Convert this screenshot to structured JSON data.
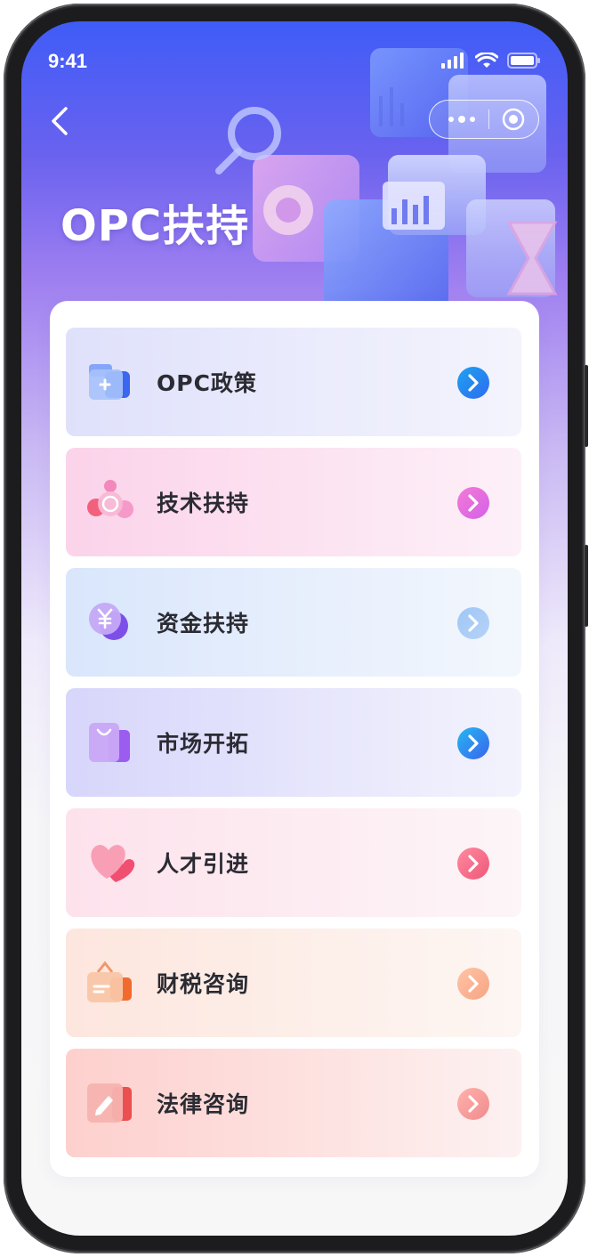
{
  "status_bar": {
    "time": "9:41"
  },
  "header": {
    "title": "OPC扶持"
  },
  "menu": [
    {
      "label": "OPC政策",
      "icon": "folder-add-icon",
      "bg_from": "#dfe1fb",
      "bg_to": "#f4f4fd",
      "arrow_from": "#1fa2f0",
      "arrow_to": "#2d6cf0"
    },
    {
      "label": "技术扶持",
      "icon": "tech-cluster-icon",
      "bg_from": "#fbd3ea",
      "bg_to": "#fdf0f8",
      "arrow_from": "#f47ad6",
      "arrow_to": "#d361e9"
    },
    {
      "label": "资金扶持",
      "icon": "yuan-coin-icon",
      "bg_from": "#d9e6fc",
      "bg_to": "#f3f7fd",
      "arrow_from": "#9ec7f6",
      "arrow_to": "#b7d2f7"
    },
    {
      "label": "市场开拓",
      "icon": "shopping-bag-icon",
      "bg_from": "#d7d6fb",
      "bg_to": "#f3f3fd",
      "arrow_from": "#25b8f0",
      "arrow_to": "#3a63ee"
    },
    {
      "label": "人才引进",
      "icon": "heart-icon",
      "bg_from": "#fde2ec",
      "bg_to": "#fdf5f8",
      "arrow_from": "#ff8aa0",
      "arrow_to": "#ef5878"
    },
    {
      "label": "财税咨询",
      "icon": "briefcase-icon",
      "bg_from": "#fde6de",
      "bg_to": "#fdf6f3",
      "arrow_from": "#ffc4a6",
      "arrow_to": "#f6a483"
    },
    {
      "label": "法律咨询",
      "icon": "document-pen-icon",
      "bg_from": "#fdd0cd",
      "bg_to": "#fdf1f1",
      "arrow_from": "#ffb2ac",
      "arrow_to": "#f08b8e"
    }
  ]
}
